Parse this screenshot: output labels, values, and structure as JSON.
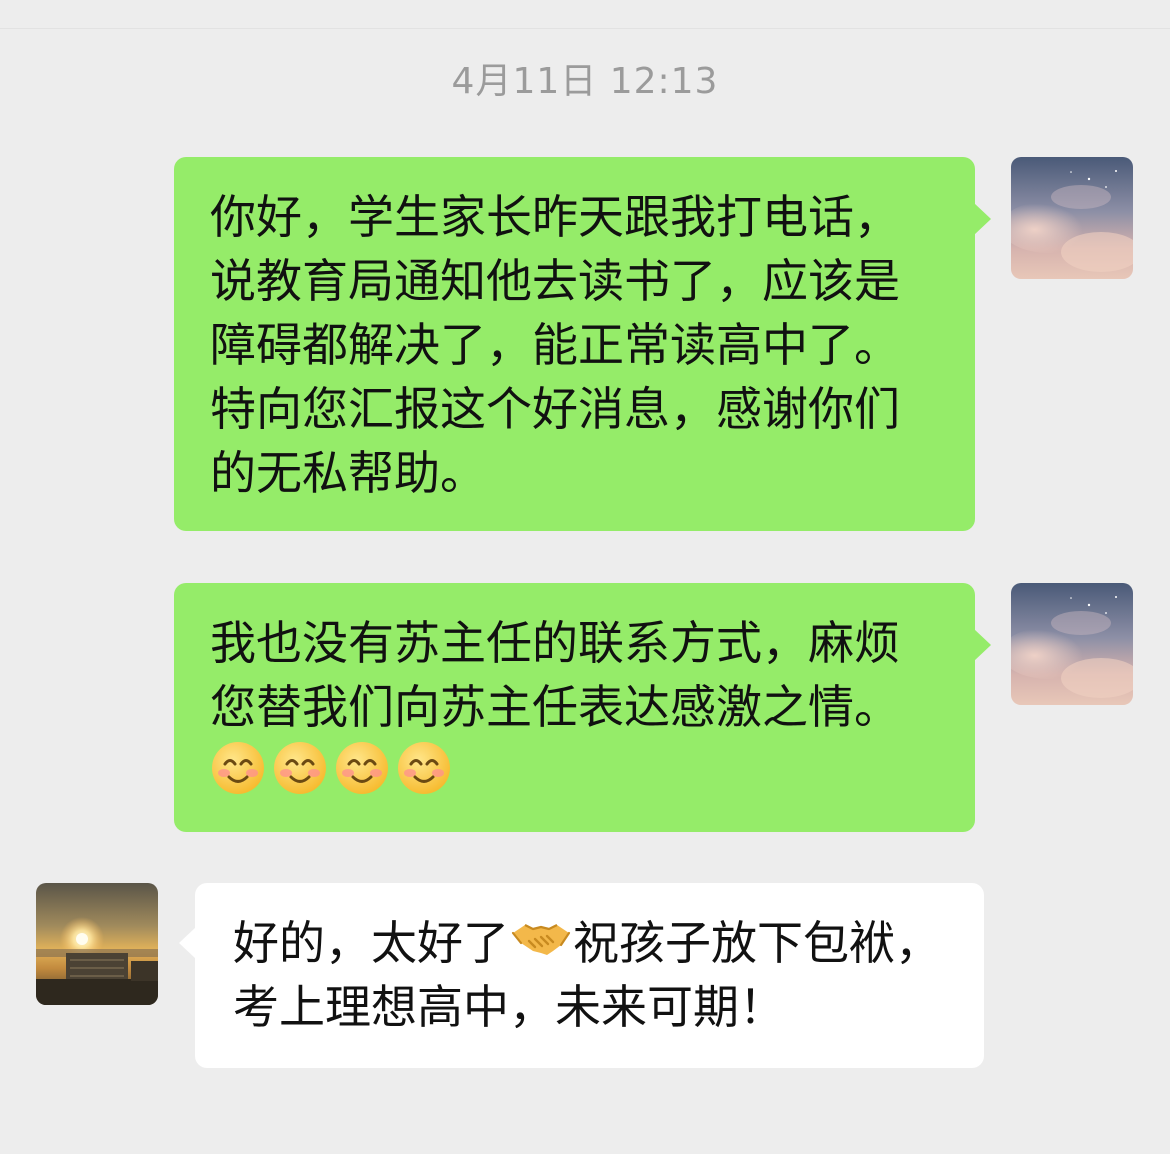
{
  "chat": {
    "timestamp": "4月11日 12:13",
    "messages": [
      {
        "sender": "me",
        "text": "你好，学生家长昨天跟我打电话，说教育局通知他去读书了，应该是障碍都解决了，能正常读高中了。特向您汇报这个好消息，感谢你们的无私帮助。"
      },
      {
        "sender": "me",
        "text_before": "我也没有苏主任的联系方式，麻烦您替我们向苏主任表达感激之情。",
        "emojis": [
          "smiling-face-with-smiling-eyes",
          "smiling-face-with-smiling-eyes",
          "smiling-face-with-smiling-eyes",
          "smiling-face-with-smiling-eyes"
        ]
      },
      {
        "sender": "other",
        "text_before": "好的，太好了",
        "emoji": "handshake",
        "text_after": "祝孩子放下包袱，考上理想高中，未来可期！"
      }
    ]
  },
  "colors": {
    "background": "#ededed",
    "my_bubble": "#95ec69",
    "other_bubble": "#ffffff",
    "timestamp_text": "#9b9b9b"
  },
  "icons": {
    "my_avatar": "sky-clouds-avatar",
    "other_avatar": "sunset-avatar"
  }
}
